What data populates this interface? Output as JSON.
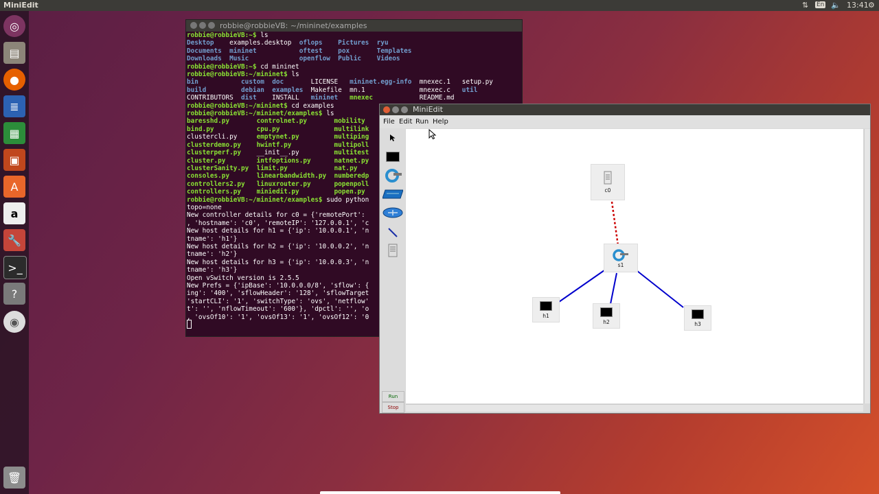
{
  "top_panel": {
    "app_title": "MiniEdit",
    "keyboard": "En",
    "clock": "13:41"
  },
  "launcher": {
    "items": [
      "ubuntu-logo",
      "files",
      "firefox",
      "writer",
      "calc",
      "impress",
      "software-center",
      "amazon",
      "settings",
      "terminal",
      "help",
      "dvd",
      "trash"
    ]
  },
  "terminal": {
    "title": "robbie@robbieVB: ~/mininet/examples",
    "lines": [
      [
        {
          "t": "robbie@robbieVB:~$ ",
          "c": "g"
        },
        {
          "t": "ls"
        }
      ],
      [
        {
          "t": "Desktop",
          "c": "b"
        },
        {
          "t": "    examples.desktop  "
        },
        {
          "t": "oflops",
          "c": "b"
        },
        {
          "t": "    "
        },
        {
          "t": "Pictures",
          "c": "b"
        },
        {
          "t": "  "
        },
        {
          "t": "ryu",
          "c": "b"
        }
      ],
      [
        {
          "t": "Documents",
          "c": "b"
        },
        {
          "t": "  "
        },
        {
          "t": "mininet",
          "c": "b"
        },
        {
          "t": "           "
        },
        {
          "t": "oftest",
          "c": "b"
        },
        {
          "t": "    "
        },
        {
          "t": "pox",
          "c": "b"
        },
        {
          "t": "       "
        },
        {
          "t": "Templates",
          "c": "b"
        }
      ],
      [
        {
          "t": "Downloads",
          "c": "b"
        },
        {
          "t": "  "
        },
        {
          "t": "Music",
          "c": "b"
        },
        {
          "t": "             "
        },
        {
          "t": "openflow",
          "c": "b"
        },
        {
          "t": "  "
        },
        {
          "t": "Public",
          "c": "b"
        },
        {
          "t": "    "
        },
        {
          "t": "Videos",
          "c": "b"
        }
      ],
      [
        {
          "t": "robbie@robbieVB:~$ ",
          "c": "g"
        },
        {
          "t": "cd mininet"
        }
      ],
      [
        {
          "t": "robbie@robbieVB:~/mininet$ ",
          "c": "g"
        },
        {
          "t": "ls"
        }
      ],
      [
        {
          "t": "bin",
          "c": "b"
        },
        {
          "t": "           "
        },
        {
          "t": "custom",
          "c": "b"
        },
        {
          "t": "  "
        },
        {
          "t": "doc",
          "c": "b"
        },
        {
          "t": "       LICENSE   "
        },
        {
          "t": "mininet.egg-info",
          "c": "b"
        },
        {
          "t": "  mnexec.1   setup.py"
        }
      ],
      [
        {
          "t": "build",
          "c": "b"
        },
        {
          "t": "         "
        },
        {
          "t": "debian",
          "c": "b"
        },
        {
          "t": "  "
        },
        {
          "t": "examples",
          "c": "b"
        },
        {
          "t": "  Makefile  mn.1              mnexec.c   "
        },
        {
          "t": "util",
          "c": "b"
        }
      ],
      [
        {
          "t": "CONTRIBUTORS  "
        },
        {
          "t": "dist",
          "c": "b"
        },
        {
          "t": "    INSTALL   "
        },
        {
          "t": "mininet",
          "c": "b"
        },
        {
          "t": "   "
        },
        {
          "t": "mnexec",
          "c": "g"
        },
        {
          "t": "            README.md"
        }
      ],
      [
        {
          "t": "robbie@robbieVB:~/mininet$ ",
          "c": "g"
        },
        {
          "t": "cd examples"
        }
      ],
      [
        {
          "t": "robbie@robbieVB:~/mininet/examples$ ",
          "c": "g"
        },
        {
          "t": "ls"
        }
      ],
      [
        {
          "t": "baresshd.py",
          "c": "g"
        },
        {
          "t": "       "
        },
        {
          "t": "controlnet.py",
          "c": "g"
        },
        {
          "t": "       "
        },
        {
          "t": "mobility",
          "c": "g"
        }
      ],
      [
        {
          "t": "bind.py",
          "c": "g"
        },
        {
          "t": "           "
        },
        {
          "t": "cpu.py",
          "c": "g"
        },
        {
          "t": "              "
        },
        {
          "t": "multilink",
          "c": "g"
        }
      ],
      [
        {
          "t": "clustercli.py     "
        },
        {
          "t": "emptynet.py",
          "c": "g"
        },
        {
          "t": "         "
        },
        {
          "t": "multiping",
          "c": "g"
        }
      ],
      [
        {
          "t": "clusterdemo.py",
          "c": "g"
        },
        {
          "t": "    "
        },
        {
          "t": "hwintf.py",
          "c": "g"
        },
        {
          "t": "           "
        },
        {
          "t": "multipoll",
          "c": "g"
        }
      ],
      [
        {
          "t": "clusterperf.py",
          "c": "g"
        },
        {
          "t": "    __init__.py         "
        },
        {
          "t": "multitest",
          "c": "g"
        }
      ],
      [
        {
          "t": "cluster.py",
          "c": "g"
        },
        {
          "t": "        "
        },
        {
          "t": "intfoptions.py",
          "c": "g"
        },
        {
          "t": "      "
        },
        {
          "t": "natnet.py",
          "c": "g"
        }
      ],
      [
        {
          "t": "clusterSanity.py",
          "c": "g"
        },
        {
          "t": "  "
        },
        {
          "t": "limit.py",
          "c": "g"
        },
        {
          "t": "            "
        },
        {
          "t": "nat.py",
          "c": "g"
        }
      ],
      [
        {
          "t": "consoles.py",
          "c": "g"
        },
        {
          "t": "       "
        },
        {
          "t": "linearbandwidth.py",
          "c": "g"
        },
        {
          "t": "  "
        },
        {
          "t": "numberedp",
          "c": "g"
        }
      ],
      [
        {
          "t": "controllers2.py",
          "c": "g"
        },
        {
          "t": "   "
        },
        {
          "t": "linuxrouter.py",
          "c": "g"
        },
        {
          "t": "      "
        },
        {
          "t": "popenpoll",
          "c": "g"
        }
      ],
      [
        {
          "t": "controllers.py",
          "c": "g"
        },
        {
          "t": "    "
        },
        {
          "t": "miniedit.py",
          "c": "g"
        },
        {
          "t": "         "
        },
        {
          "t": "popen.py",
          "c": "g"
        }
      ],
      [
        {
          "t": "robbie@robbieVB:~/mininet/examples$ ",
          "c": "g"
        },
        {
          "t": "sudo python"
        }
      ],
      [
        {
          "t": "topo=none"
        }
      ],
      [
        {
          "t": "New controller details for c0 = {'remotePort':"
        }
      ],
      [
        {
          "t": ", 'hostname': 'c0', 'remoteIP': '127.0.0.1', 'c"
        }
      ],
      [
        {
          "t": "New host details for h1 = {'ip': '10.0.0.1', 'n"
        }
      ],
      [
        {
          "t": "tname': 'h1'}"
        }
      ],
      [
        {
          "t": "New host details for h2 = {'ip': '10.0.0.2', 'n"
        }
      ],
      [
        {
          "t": "tname': 'h2'}"
        }
      ],
      [
        {
          "t": "New host details for h3 = {'ip': '10.0.0.3', 'n"
        }
      ],
      [
        {
          "t": "tname': 'h3'}"
        }
      ],
      [
        {
          "t": "Open vSwitch version is 2.5.5"
        }
      ],
      [
        {
          "t": "New Prefs = {'ipBase': '10.0.0.0/8', 'sflow': {"
        }
      ],
      [
        {
          "t": "ing': '400', 'sflowHeader': '128', 'sflowTarget"
        }
      ],
      [
        {
          "t": "'startCLI': '1', 'switchType': 'ovs', 'netflow'"
        }
      ],
      [
        {
          "t": "t': '', 'nflowTimeout': '600'}, 'dpctl': '', 'o"
        }
      ],
      [
        {
          "t": ", 'ovsOf10': '1', 'ovsOf13': '1', 'ovsOf12': '0"
        }
      ]
    ]
  },
  "miniedit": {
    "title": "MiniEdit",
    "menu": [
      "File",
      "Edit",
      "Run",
      "Help"
    ],
    "run_label": "Run",
    "stop_label": "Stop",
    "nodes": {
      "c0": "c0",
      "s1": "s1",
      "h1": "h1",
      "h2": "h2",
      "h3": "h3"
    }
  },
  "colors": {
    "link": "#0000cc",
    "controller_link": "#cc0000",
    "run": "#006400",
    "stop": "#8b0000"
  }
}
